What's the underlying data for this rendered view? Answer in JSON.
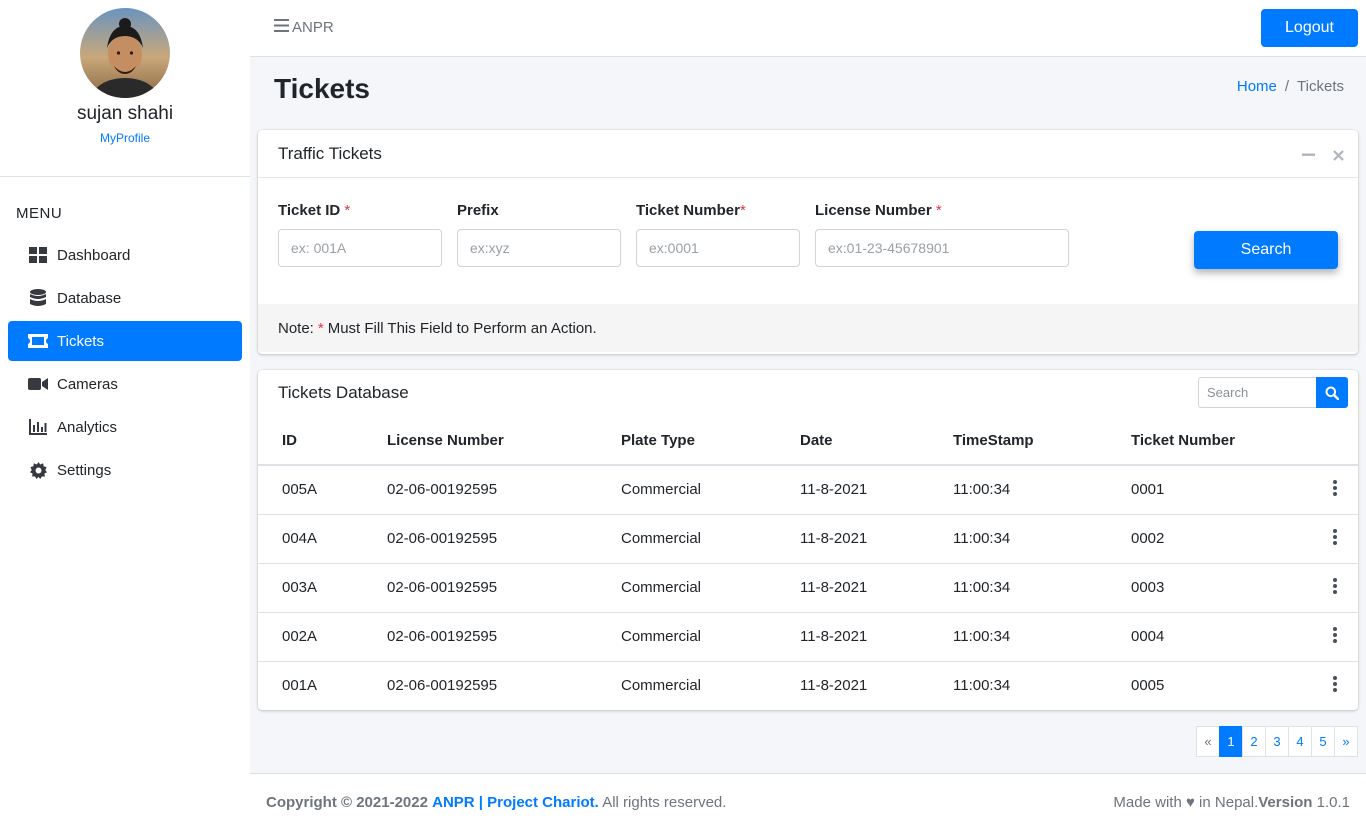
{
  "user": {
    "name": "sujan shahi",
    "profile_link": "MyProfile"
  },
  "sidebar": {
    "menu_label": "MENU",
    "items": [
      {
        "label": "Dashboard",
        "icon": "dashboard-icon",
        "active": false
      },
      {
        "label": "Database",
        "icon": "database-icon",
        "active": false
      },
      {
        "label": "Tickets",
        "icon": "ticket-icon",
        "active": true
      },
      {
        "label": "Cameras",
        "icon": "video-camera-icon",
        "active": false
      },
      {
        "label": "Analytics",
        "icon": "chart-icon",
        "active": false
      },
      {
        "label": "Settings",
        "icon": "gear-icon",
        "active": false
      }
    ]
  },
  "topbar": {
    "brand": "ANPR",
    "logout_label": "Logout"
  },
  "page": {
    "title": "Tickets",
    "breadcrumb": {
      "home": "Home",
      "separator": "/",
      "current": "Tickets"
    }
  },
  "traffic_tickets": {
    "title": "Traffic Tickets",
    "fields": {
      "ticket_id": {
        "label": "Ticket ID",
        "required_mark": "*",
        "placeholder": "ex: 001A"
      },
      "prefix": {
        "label": "Prefix",
        "placeholder": "ex:xyz"
      },
      "ticket_number": {
        "label": "Ticket Number",
        "required_mark": "*",
        "placeholder": "ex:0001"
      },
      "license_number": {
        "label": "License Number",
        "required_mark": "*",
        "placeholder": "ex:01-23-45678901"
      }
    },
    "search_label": "Search",
    "note": {
      "prefix": "Note:",
      "mark": "*",
      "text": "Must Fill This Field to Perform an Action."
    }
  },
  "tickets_db": {
    "title": "Tickets Database",
    "search_placeholder": "Search",
    "columns": [
      "ID",
      "License Number",
      "Plate Type",
      "Date",
      "TimeStamp",
      "Ticket Number"
    ],
    "rows": [
      [
        "005A",
        "02-06-00192595",
        "Commercial",
        "11-8-2021",
        "11:00:34",
        "0001"
      ],
      [
        "004A",
        "02-06-00192595",
        "Commercial",
        "11-8-2021",
        "11:00:34",
        "0002"
      ],
      [
        "003A",
        "02-06-00192595",
        "Commercial",
        "11-8-2021",
        "11:00:34",
        "0003"
      ],
      [
        "002A",
        "02-06-00192595",
        "Commercial",
        "11-8-2021",
        "11:00:34",
        "0004"
      ],
      [
        "001A",
        "02-06-00192595",
        "Commercial",
        "11-8-2021",
        "11:00:34",
        "0005"
      ]
    ]
  },
  "pagination": {
    "prev": "«",
    "pages": [
      "1",
      "2",
      "3",
      "4",
      "5"
    ],
    "current": "1",
    "next": "»"
  },
  "footer": {
    "copyright": "Copyright © 2021-2022",
    "brand": "ANPR | Project Chariot.",
    "rights": "All rights reserved.",
    "made_with": "Made with",
    "heart": "♥",
    "in_nepal": "in Nepal.",
    "version_label": "Version",
    "version": "1.0.1"
  },
  "colors": {
    "primary": "#007bff",
    "danger": "#dc3545",
    "background": "#f4f6f9"
  }
}
